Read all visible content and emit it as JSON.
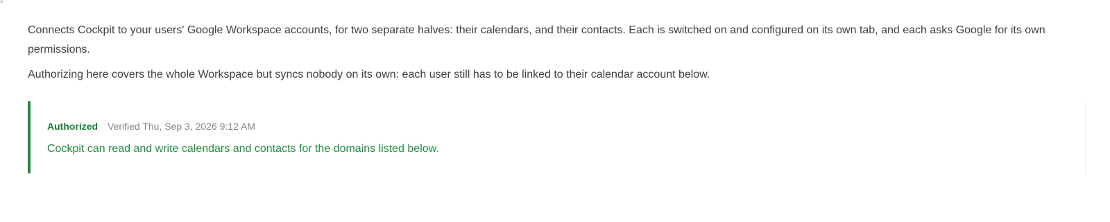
{
  "intro": {
    "paragraph": "Connects Cockpit to your users' Google Workspace accounts, for two separate halves: their calendars, and their contacts. Each is switched on and configured on its own tab, and each asks Google for its own permissions.",
    "note": "Authorizing here covers the whole Workspace but syncs nobody on its own: each user still has to be linked to their calendar account below."
  },
  "status": {
    "label": "Authorized",
    "verified": "Verified Thu, Sep 3, 2026 9:12 AM",
    "description": "Cockpit can read and write calendars and contacts for the domains listed below.",
    "accent_color": "#1e8e3e"
  }
}
